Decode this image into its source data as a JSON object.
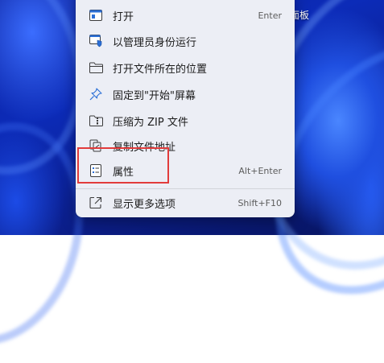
{
  "desktop": {
    "partial_label": "面板",
    "colors": {
      "wallpaper_primary": "#0c2bb8",
      "wallpaper_accent": "#4a86ff"
    }
  },
  "context_menu": {
    "background": "#eceef5",
    "items": [
      {
        "label": "打开",
        "shortcut": "Enter",
        "icon": "open-app-icon"
      },
      {
        "label": "以管理员身份运行",
        "shortcut": "",
        "icon": "run-as-admin-shield-icon"
      },
      {
        "label": "打开文件所在的位置",
        "shortcut": "",
        "icon": "folder-icon"
      },
      {
        "label": "固定到\"开始\"屏幕",
        "shortcut": "",
        "icon": "pin-icon"
      },
      {
        "label": "压缩为 ZIP 文件",
        "shortcut": "",
        "icon": "zip-folder-icon"
      },
      {
        "label": "复制文件地址",
        "shortcut": "",
        "icon": "copy-path-icon"
      },
      {
        "label": "属性",
        "shortcut": "Alt+Enter",
        "icon": "properties-icon"
      },
      {
        "label": "显示更多选项",
        "shortcut": "Shift+F10",
        "icon": "more-options-icon"
      }
    ]
  },
  "annotation": {
    "highlight_color": "#e23b3b",
    "highlighted_item": "属性"
  }
}
